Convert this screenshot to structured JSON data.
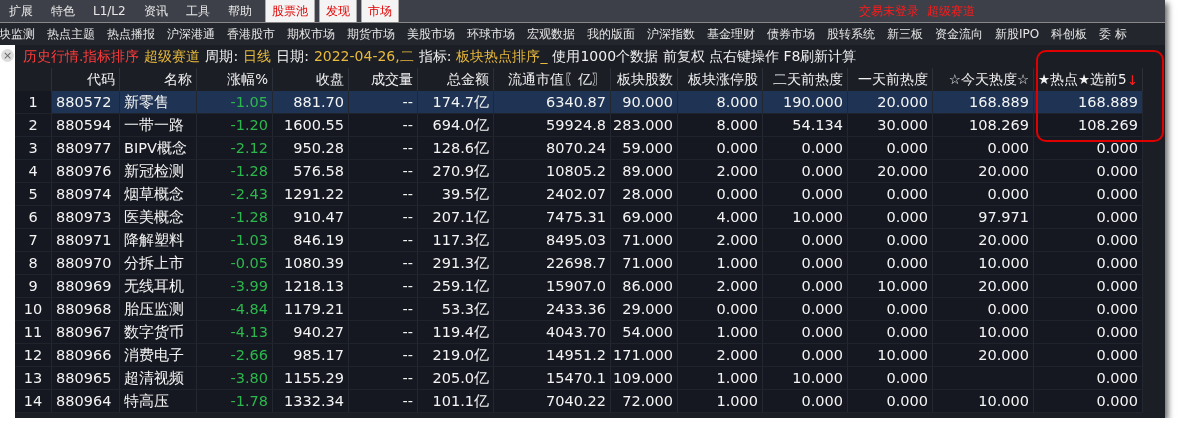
{
  "menu_bar": {
    "items": [
      "扩展",
      "特色",
      "L1/L2",
      "资讯",
      "工具",
      "帮助"
    ],
    "tabs": [
      "股票池",
      "发现",
      "市场"
    ],
    "status": "交易未登录  超级赛道"
  },
  "nav_bar": {
    "items": [
      "块监测",
      "热点主题",
      "热点播报",
      "沪深港通",
      "香港股市",
      "期权市场",
      "期货市场",
      "美股市场",
      "环球市场",
      "宏观数据",
      "我的版面",
      "沪深指数",
      "基金理财",
      "债券市场",
      "股转系统",
      "新三板",
      "资金流向",
      "新股IPO",
      "科创板",
      "委 标"
    ]
  },
  "info_bar": {
    "close": "×",
    "segments": [
      {
        "kind": "title",
        "text": "历史行情.指标排序"
      },
      {
        "kind": "value",
        "text": "超级赛道"
      },
      {
        "kind": "label",
        "text": "周期:"
      },
      {
        "kind": "value",
        "text": "日线"
      },
      {
        "kind": "label",
        "text": "日期:"
      },
      {
        "kind": "value",
        "text": "2022-04-26,二"
      },
      {
        "kind": "label",
        "text": "指标:"
      },
      {
        "kind": "value",
        "text": "板块热点排序_"
      },
      {
        "kind": "label",
        "text": "使用1000个数据 前复权 点右键操作 F8刷新计算"
      }
    ]
  },
  "table": {
    "columns": [
      {
        "kind": "index"
      },
      {
        "label": "代码",
        "kind": "code"
      },
      {
        "label": "名称",
        "kind": "text"
      },
      {
        "label": "涨幅%",
        "kind": "change"
      },
      {
        "label": "收盘",
        "kind": "number"
      },
      {
        "label": "成交量",
        "kind": "number"
      },
      {
        "label": "总金额",
        "kind": "number"
      },
      {
        "label": "流通市值〖亿〗",
        "kind": "number"
      },
      {
        "label": "板块股数",
        "kind": "number"
      },
      {
        "label": "板块涨停股",
        "kind": "number"
      },
      {
        "label": "二天前热度",
        "kind": "number"
      },
      {
        "label": "一天前热度",
        "kind": "number"
      },
      {
        "label": "☆今天热度☆",
        "kind": "number"
      },
      {
        "label": "★热点★选前5",
        "kind": "number",
        "sort": "↓"
      }
    ],
    "rows": [
      {
        "selected": true,
        "cells": [
          "1",
          "880572",
          "新零售",
          "-1.05",
          "881.70",
          "--",
          "174.7亿",
          "6340.87",
          "90.000",
          "8.000",
          "190.000",
          "20.000",
          "168.889",
          "168.889"
        ]
      },
      {
        "selected": false,
        "cells": [
          "2",
          "880594",
          "一带一路",
          "-1.20",
          "1600.55",
          "--",
          "694.0亿",
          "59924.8",
          "283.000",
          "8.000",
          "54.134",
          "30.000",
          "108.269",
          "108.269"
        ]
      },
      {
        "selected": false,
        "cells": [
          "3",
          "880977",
          "BIPV概念",
          "-2.12",
          "950.28",
          "--",
          "128.6亿",
          "8070.24",
          "59.000",
          "0.000",
          "0.000",
          "0.000",
          "0.000",
          "0.000"
        ]
      },
      {
        "selected": false,
        "cells": [
          "4",
          "880976",
          "新冠检测",
          "-1.28",
          "576.58",
          "--",
          "270.9亿",
          "10805.2",
          "89.000",
          "2.000",
          "0.000",
          "20.000",
          "20.000",
          "0.000"
        ]
      },
      {
        "selected": false,
        "cells": [
          "5",
          "880974",
          "烟草概念",
          "-2.43",
          "1291.22",
          "--",
          "39.5亿",
          "2402.07",
          "28.000",
          "0.000",
          "0.000",
          "0.000",
          "0.000",
          "0.000"
        ]
      },
      {
        "selected": false,
        "cells": [
          "6",
          "880973",
          "医美概念",
          "-1.28",
          "910.47",
          "--",
          "207.1亿",
          "7475.31",
          "69.000",
          "4.000",
          "10.000",
          "0.000",
          "97.971",
          "0.000"
        ]
      },
      {
        "selected": false,
        "cells": [
          "7",
          "880971",
          "降解塑料",
          "-1.03",
          "846.19",
          "--",
          "117.3亿",
          "8495.03",
          "71.000",
          "2.000",
          "0.000",
          "0.000",
          "20.000",
          "0.000"
        ]
      },
      {
        "selected": false,
        "cells": [
          "8",
          "880970",
          "分拆上市",
          "-0.05",
          "1080.39",
          "--",
          "291.3亿",
          "22698.7",
          "71.000",
          "1.000",
          "0.000",
          "0.000",
          "10.000",
          "0.000"
        ]
      },
      {
        "selected": false,
        "cells": [
          "9",
          "880969",
          "无线耳机",
          "-3.99",
          "1218.13",
          "--",
          "259.1亿",
          "15907.0",
          "86.000",
          "2.000",
          "0.000",
          "10.000",
          "20.000",
          "0.000"
        ]
      },
      {
        "selected": false,
        "cells": [
          "10",
          "880968",
          "胎压监测",
          "-4.84",
          "1179.21",
          "--",
          "53.3亿",
          "2433.36",
          "29.000",
          "0.000",
          "0.000",
          "0.000",
          "0.000",
          "0.000"
        ]
      },
      {
        "selected": false,
        "cells": [
          "11",
          "880967",
          "数字货币",
          "-4.13",
          "940.27",
          "--",
          "119.4亿",
          "4043.70",
          "54.000",
          "1.000",
          "0.000",
          "0.000",
          "10.000",
          "0.000"
        ]
      },
      {
        "selected": false,
        "cells": [
          "12",
          "880966",
          "消费电子",
          "-2.66",
          "985.17",
          "--",
          "219.0亿",
          "14951.2",
          "171.000",
          "2.000",
          "0.000",
          "10.000",
          "20.000",
          "0.000"
        ]
      },
      {
        "selected": false,
        "cells": [
          "13",
          "880965",
          "超清视频",
          "-3.80",
          "1155.29",
          "--",
          "205.0亿",
          "15470.1",
          "109.000",
          "1.000",
          "10.000",
          "0.000",
          null,
          "0.000"
        ]
      },
      {
        "selected": false,
        "cells": [
          "14",
          "880964",
          "特高压",
          "-1.78",
          "1332.34",
          "--",
          "101.1亿",
          "7040.22",
          "72.000",
          "1.000",
          "0.000",
          "0.000",
          "10.000",
          "0.000"
        ]
      }
    ]
  }
}
